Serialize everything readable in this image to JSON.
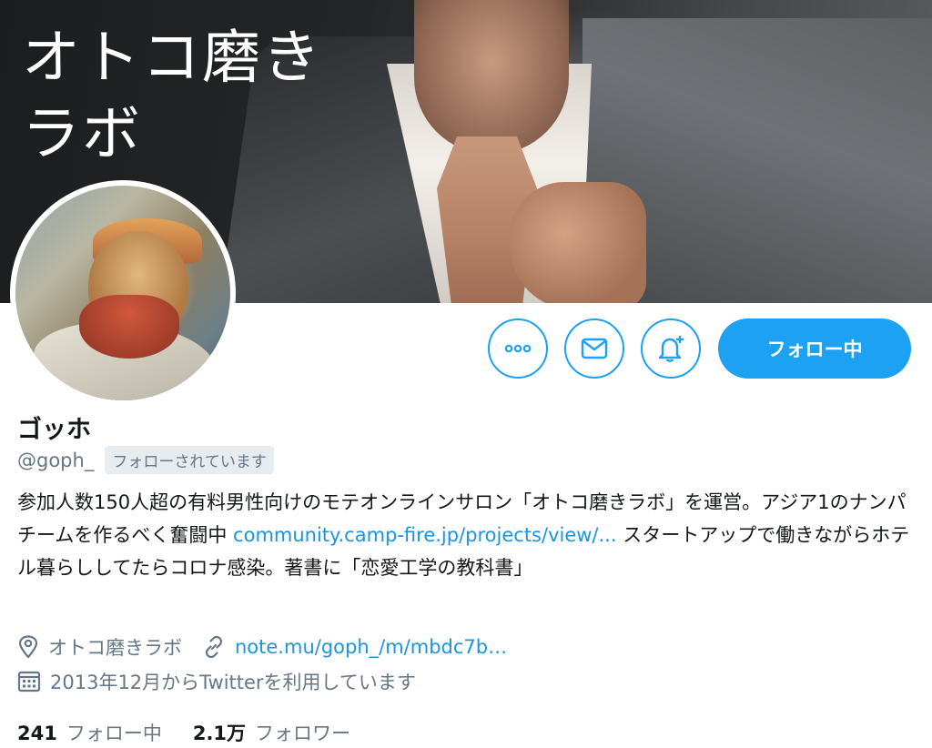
{
  "header": {
    "banner_text_line1": "オトコ磨き",
    "banner_text_line2": "ラボ"
  },
  "actions": {
    "more_icon": "more-icon",
    "dm_icon": "mail-icon",
    "notify_icon": "bell-plus-icon",
    "follow_label": "フォロー中",
    "accent_color": "#1da1f2"
  },
  "profile": {
    "name": "ゴッホ",
    "handle": "@goph_",
    "follows_you": "フォローされています",
    "bio_part1": "参加人数150人超の有料男性向けのモテオンラインサロン「オトコ磨きラボ」を運営。アジア1のナンパチームを作るべく奮闘中 ",
    "bio_link": "community.camp-fire.jp/projects/view/...",
    "bio_part2": " スタートアップで働きながらホテル暮らししてたらコロナ感染。著書に「恋愛工学の教科書」",
    "location": "オトコ磨きラボ",
    "website": "note.mu/goph_/m/mbdc7b…",
    "joined": "2013年12月からTwitterを利用しています"
  },
  "stats": {
    "following_count": "241",
    "following_label": "フォロー中",
    "followers_count": "2.1万",
    "followers_label": "フォロワー"
  }
}
